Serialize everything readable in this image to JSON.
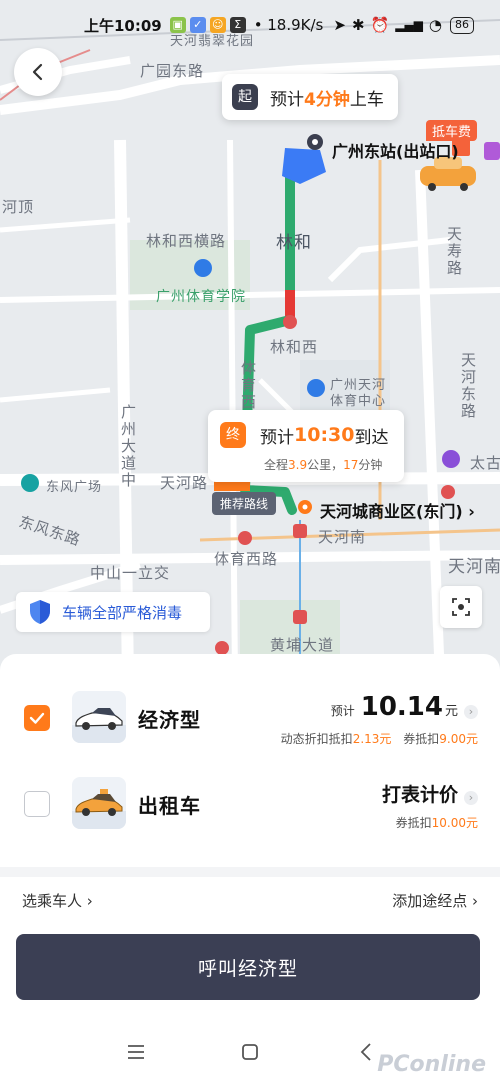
{
  "status_bar": {
    "time": "上午10:09",
    "net_speed": "18.9K/s",
    "battery": "86"
  },
  "map": {
    "labels": {
      "guangyuan": "广园东路",
      "tianhe_garden": "天河翡翠花园",
      "linhexi_hengtu": "林和西横路",
      "linhe": "林和",
      "sports_college": "广州体育学院",
      "linhexi": "林和西",
      "tianhe_sports_center": "广州天河\n体育中心",
      "sports_west": "体育西路",
      "guangzhou_avenue": "广州大道中",
      "tianhe_road": "天河路",
      "dongfeng_square": "东风广场",
      "dongfeng_road": "东风东路",
      "zhongshan": "中山一立交",
      "tianhe_nan": "天河南",
      "sports_west_road": "体育西路",
      "huangpu": "黄埔大道",
      "tianshou": "天寿路",
      "tianhe_north": "天河东路",
      "tianhe_nan2": "天河南",
      "he_side": "河顶",
      "tai": "太古"
    }
  },
  "pickup": {
    "badge": "起",
    "prefix": "预计",
    "minutes": "4分钟",
    "suffix": "上车"
  },
  "station": {
    "name": "广州东站(出站口)",
    "fee_tag": "抵车费"
  },
  "destination": {
    "badge": "终",
    "prefix": "预计",
    "time": "10:30",
    "suffix": "到达",
    "dist_prefix": "全程",
    "distance": "3.9",
    "dist_unit": "公里，",
    "duration": "17",
    "dur_unit": "分钟",
    "route_tag": "推荐路线",
    "name": "天河城商业区(东门)"
  },
  "disinfect_text": "车辆全部严格消毒",
  "options": [
    {
      "name": "经济型",
      "checked": true,
      "price_prefix": "预计",
      "price": "10.14",
      "unit": "元",
      "sub1_label": "动态折扣抵扣",
      "sub1_value": "2.13元",
      "sub2_label": "券抵扣",
      "sub2_value": "9.00元"
    },
    {
      "name": "出租车",
      "checked": false,
      "price_text": "打表计价",
      "sub2_label": "券抵扣",
      "sub2_value": "10.00元"
    }
  ],
  "links": {
    "passenger": "选乘车人",
    "waypoint": "添加途经点"
  },
  "call_button": "呼叫经济型",
  "watermark": "PConline",
  "colors": {
    "accent": "#ff7a1a",
    "button": "#3b3f54",
    "route": "#2eaa6e",
    "route_red": "#e53935",
    "route_blue": "#3b7bf5"
  }
}
